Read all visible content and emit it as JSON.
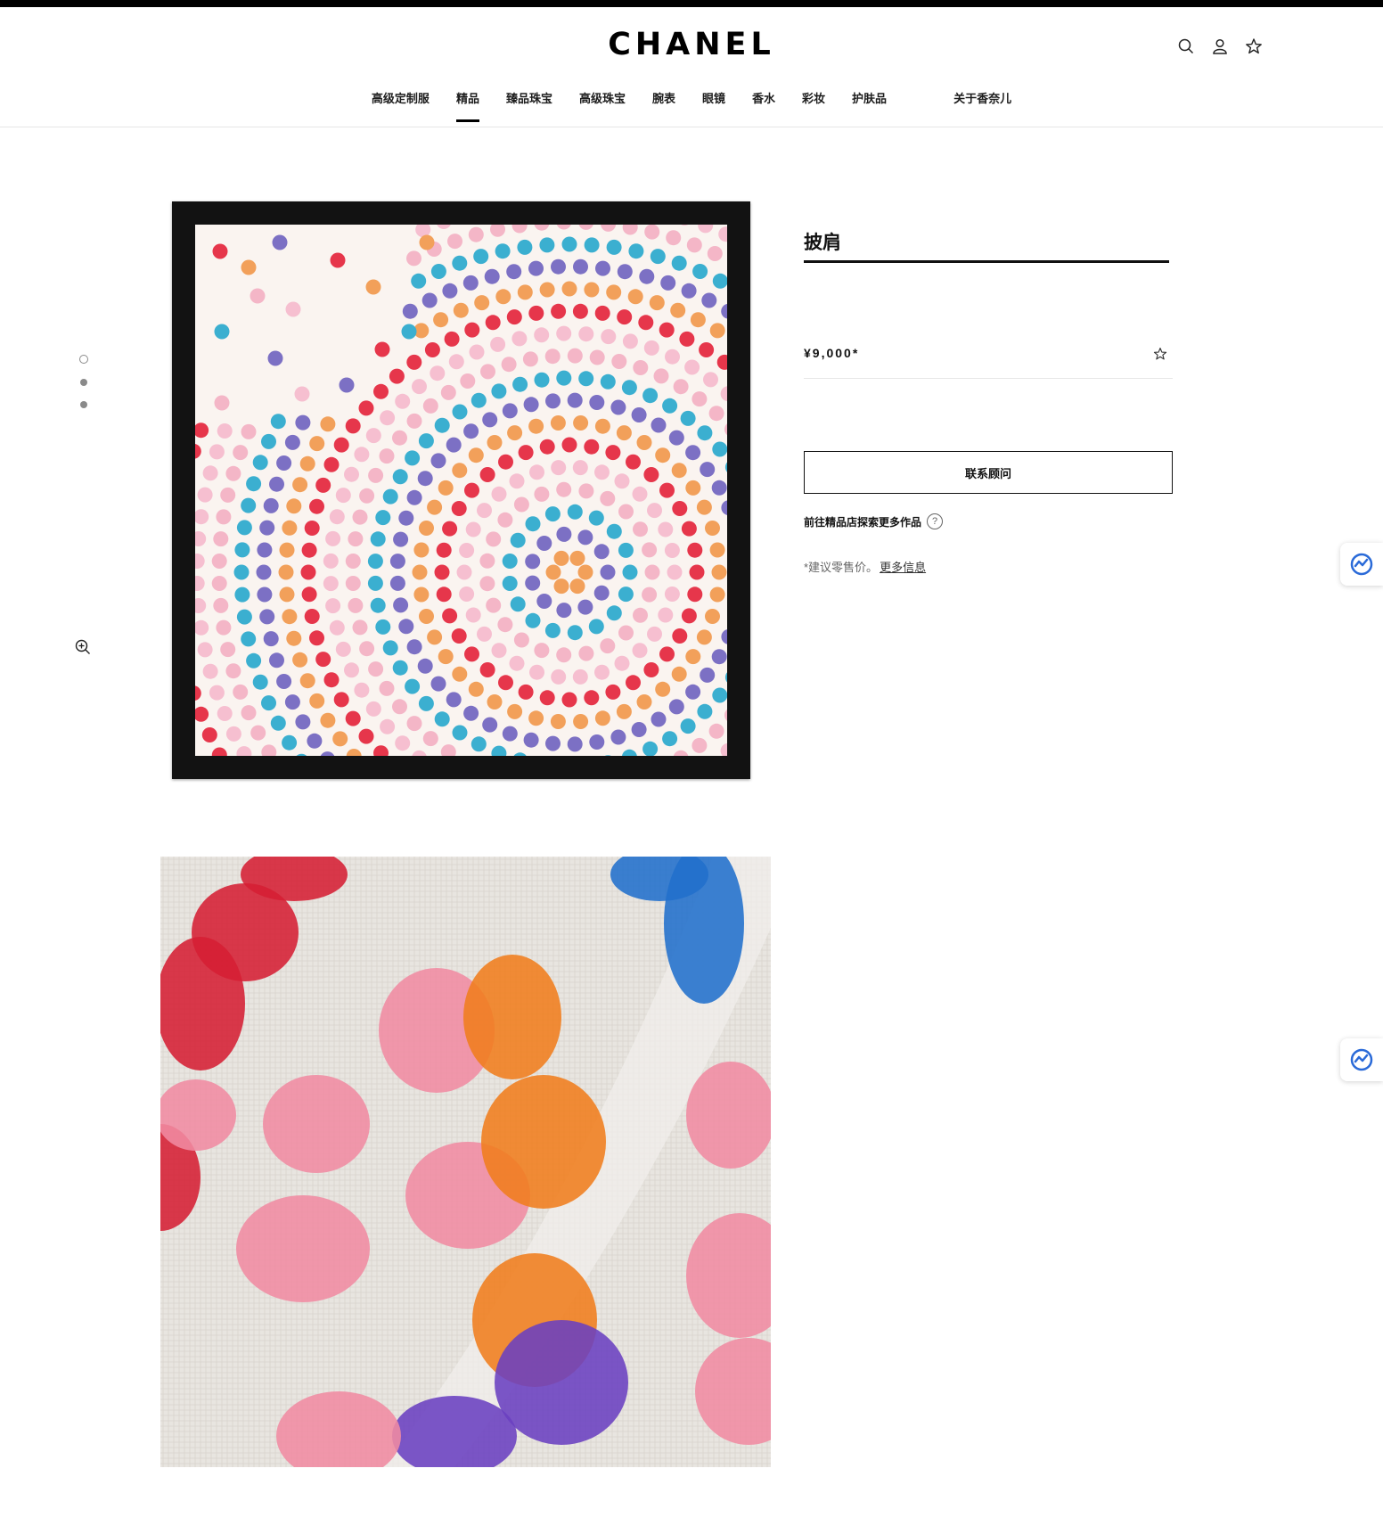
{
  "brand": {
    "logo_text": "CHANEL"
  },
  "header": {
    "icons": [
      "search-icon",
      "account-icon",
      "wishlist-star-icon"
    ]
  },
  "nav": {
    "items": [
      {
        "label": "高级定制服"
      },
      {
        "label": "精品",
        "active": true
      },
      {
        "label": "臻品珠宝"
      },
      {
        "label": "高级珠宝"
      },
      {
        "label": "腕表"
      },
      {
        "label": "眼镜"
      },
      {
        "label": "香水"
      },
      {
        "label": "彩妆"
      },
      {
        "label": "护肤品"
      },
      {
        "label": "关于香奈儿"
      }
    ]
  },
  "gallery": {
    "slide_count": 3,
    "active_slide": 1,
    "zoom_icon": "zoom-in-icon",
    "scarf_palette": [
      "#e6364b",
      "#f2a05a",
      "#7c70c4",
      "#3bafd0",
      "#f4b6c7",
      "#f6bfd0"
    ],
    "photo_palette": [
      "#d51f33",
      "#f08ba2",
      "#f07d1d",
      "#6a40c0",
      "#2170cc"
    ]
  },
  "product": {
    "title": "披肩",
    "price": "¥9,000*",
    "contact_button": "联系顾问",
    "explore_text": "前往精品店探索更多作品",
    "help_symbol": "?",
    "note_prefix": "*建议零售价。",
    "note_link": "更多信息"
  },
  "colors": {
    "text": "#1d1d1d",
    "border": "#111111",
    "divider": "#e6e6e6",
    "widget_accent": "#2a6ad8"
  }
}
